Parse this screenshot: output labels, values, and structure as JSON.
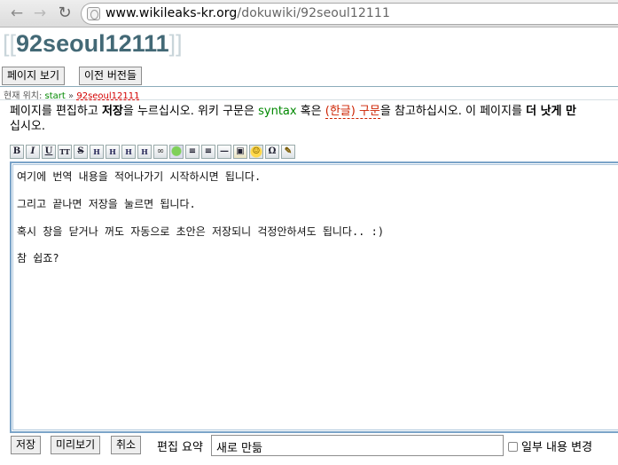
{
  "browser": {
    "url_host": "www.wikileaks-kr.org",
    "url_path": "/dokuwiki/92seoul12111"
  },
  "page": {
    "title_open": "[[",
    "title": "92seoul12111",
    "title_close": "]]",
    "btn_show": "페이지 보기",
    "btn_revisions": "이전 버전들"
  },
  "breadcrumb": {
    "prefix": "현재 위치:",
    "start": "start",
    "sep": "»",
    "current": "92seoul12111"
  },
  "intro": {
    "t1": "페이지를 편집하고 ",
    "t2": "저장",
    "t3": "을 누르십시오. 위키 구문은 ",
    "syntax": "syntax",
    "t4": " 혹은 ",
    "hangul": "(한글) 구문",
    "t5": "을 참고하십시오. 이 페이지를 ",
    "t6": "더 낫게 만",
    "line2": "십시오."
  },
  "toolbar": {
    "bold": "B",
    "italic": "I",
    "underline": "U",
    "mono": "TT",
    "strike": "S",
    "h1": "H",
    "h2": "H",
    "h3": "H",
    "h4": "H",
    "link": "∞"
  },
  "editor": {
    "lines": [
      "여기에 번역 내용을 적어나가기 시작하시면 됩니다.",
      "그리고 끝나면 저장을 눌르면 됩니다.",
      "혹시 창을 닫거나 꺼도 자동으로 초안은 저장되니 걱정안하셔도 됩니다.. :)",
      "참 쉽죠?"
    ]
  },
  "footer": {
    "save": "저장",
    "preview": "미리보기",
    "cancel": "취소",
    "summary_label": "편집 요약",
    "summary_value": "새로 만듦",
    "minor_label": "일부 내용 변경"
  }
}
